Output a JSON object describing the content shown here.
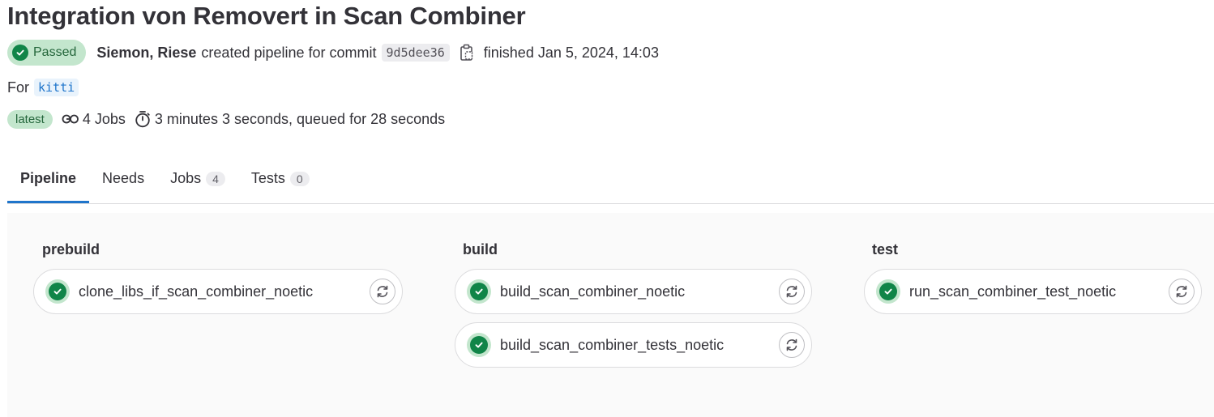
{
  "pipeline": {
    "title": "Integration von Removert in Scan Combiner",
    "status": "Passed",
    "author": "Siemon, Riese",
    "created_text": "created pipeline for commit",
    "commit_sha": "9d5dee36",
    "finished_text": "finished Jan 5, 2024, 14:03",
    "for_label": "For",
    "ref": "kitti",
    "latest_label": "latest",
    "jobs_text": "4 Jobs",
    "duration_text": "3 minutes 3 seconds, queued for 28 seconds"
  },
  "tabs": [
    {
      "label": "Pipeline"
    },
    {
      "label": "Needs"
    },
    {
      "label": "Jobs",
      "count": "4"
    },
    {
      "label": "Tests",
      "count": "0"
    }
  ],
  "stages": [
    {
      "name": "prebuild",
      "jobs": [
        "clone_libs_if_scan_combiner_noetic"
      ]
    },
    {
      "name": "build",
      "jobs": [
        "build_scan_combiner_noetic",
        "build_scan_combiner_tests_noetic"
      ]
    },
    {
      "name": "test",
      "jobs": [
        "run_scan_combiner_test_noetic"
      ]
    }
  ],
  "colors": {
    "success": "#108548",
    "success_bg": "#c3e6cd",
    "link": "#1f75cb"
  },
  "icons": {
    "status": "check-circle-icon",
    "copy": "copy-to-clipboard-icon",
    "jobs": "pipeline-jobs-icon",
    "timer": "timer-icon",
    "retry": "retry-icon"
  }
}
